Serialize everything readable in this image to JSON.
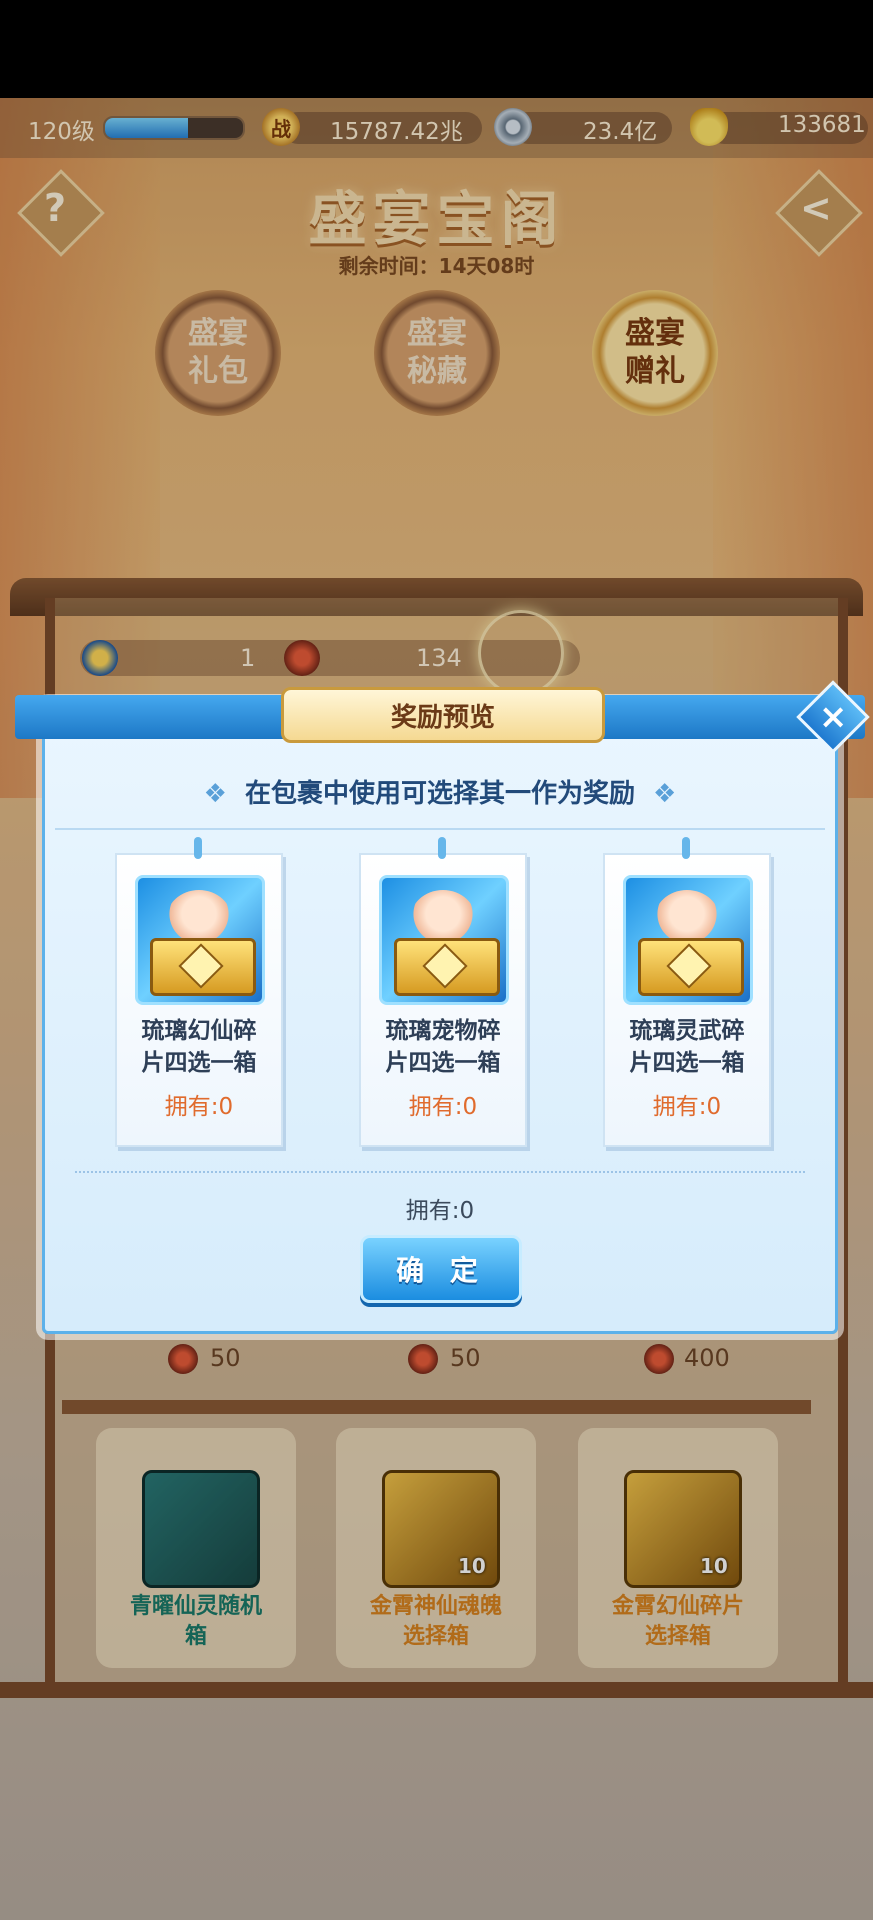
{
  "topbar": {
    "level": "120级",
    "level_progress": 0.6,
    "combat_power_icon": "战",
    "combat_power": "15787.42兆",
    "coins": "23.4亿",
    "gold_ingots": "133681"
  },
  "header": {
    "title": "盛宴宝阁",
    "remaining_time": "剩余时间：14天08时",
    "help_label": "?",
    "back_label": "<"
  },
  "tabs": [
    {
      "label_line1": "盛宴",
      "label_line2": "礼包",
      "selected": false
    },
    {
      "label_line1": "盛宴",
      "label_line2": "秘藏",
      "selected": false
    },
    {
      "label_line1": "盛宴",
      "label_line2": "赠礼",
      "selected": true
    }
  ],
  "currency_row": {
    "star_count": "1",
    "token_count": "134"
  },
  "shelf": {
    "prices": [
      "50",
      "50",
      "400"
    ],
    "items": [
      {
        "name_line1": "青曜仙灵随机",
        "name_line2": "箱",
        "count": ""
      },
      {
        "name_line1": "金霄神仙魂魄",
        "name_line2": "选择箱",
        "count": "10"
      },
      {
        "name_line1": "金霄幻仙碎片",
        "name_line2": "选择箱",
        "count": "10"
      }
    ]
  },
  "modal": {
    "title": "奖励预览",
    "instruction": "在包裹中使用可选择其一作为奖励",
    "close_label": "×",
    "cards": [
      {
        "name_line1": "琉璃幻仙碎",
        "name_line2": "片四选一箱",
        "owned": "拥有:0"
      },
      {
        "name_line1": "琉璃宠物碎",
        "name_line2": "片四选一箱",
        "owned": "拥有:0"
      },
      {
        "name_line1": "琉璃灵武碎",
        "name_line2": "片四选一箱",
        "owned": "拥有:0"
      }
    ],
    "owned_total": "拥有:0",
    "confirm_label": "确 定"
  },
  "colors": {
    "accent_blue": "#1d78c6",
    "owned_orange": "#e06b2d",
    "title_gold": "#f7dfb0"
  }
}
